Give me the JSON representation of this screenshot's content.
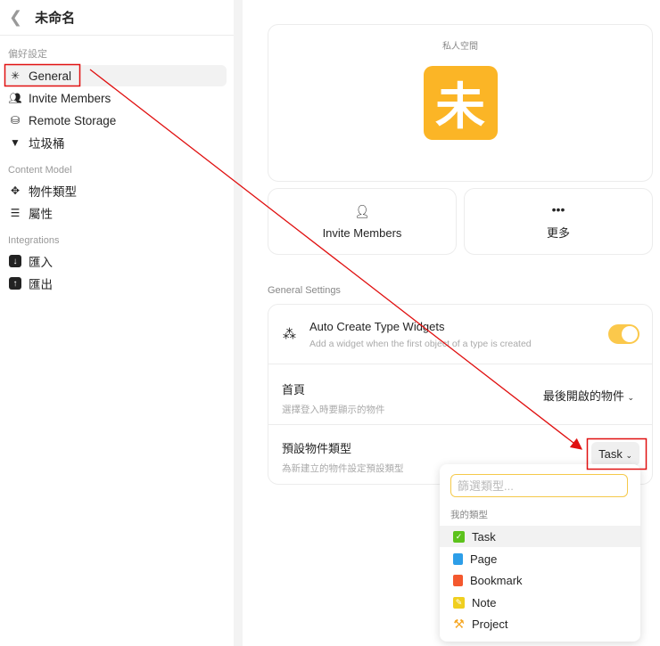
{
  "sidebar": {
    "back_icon": "chevron-left",
    "title": "未命名",
    "sections": [
      {
        "label": "偏好設定",
        "items": [
          "General",
          "Invite Members",
          "Remote Storage",
          "垃圾桶"
        ]
      },
      {
        "label": "Content Model",
        "items": [
          "物件類型",
          "屬性"
        ]
      },
      {
        "label": "Integrations",
        "items": [
          "匯入",
          "匯出"
        ]
      }
    ]
  },
  "space": {
    "label": "私人空間",
    "avatar_char": "未",
    "avatar_color": "#fbb526",
    "actions": [
      {
        "label": "Invite Members",
        "icon": "user-gear-icon"
      },
      {
        "label": "更多",
        "icon": "ellipsis-icon"
      }
    ]
  },
  "settings": {
    "section_label": "General Settings",
    "auto_create": {
      "title": "Auto Create Type Widgets",
      "subtitle": "Add a widget when the first object of a type is created",
      "enabled": true
    },
    "homepage": {
      "title": "首頁",
      "subtitle": "選擇登入時要顯示的物件",
      "value": "最後開啟的物件"
    },
    "default_type": {
      "title": "預設物件類型",
      "subtitle": "為新建立的物件設定預設類型",
      "value": "Task"
    }
  },
  "dropdown": {
    "placeholder": "篩選類型...",
    "header": "我的類型",
    "options": [
      {
        "label": "Task",
        "color": "#5cc21c"
      },
      {
        "label": "Page",
        "color": "#2d9ee8"
      },
      {
        "label": "Bookmark",
        "color": "#f4582e"
      },
      {
        "label": "Note",
        "color": "#f0cf1f"
      },
      {
        "label": "Project",
        "color": "#f5a623"
      }
    ]
  },
  "annotation_color": "#e01010"
}
